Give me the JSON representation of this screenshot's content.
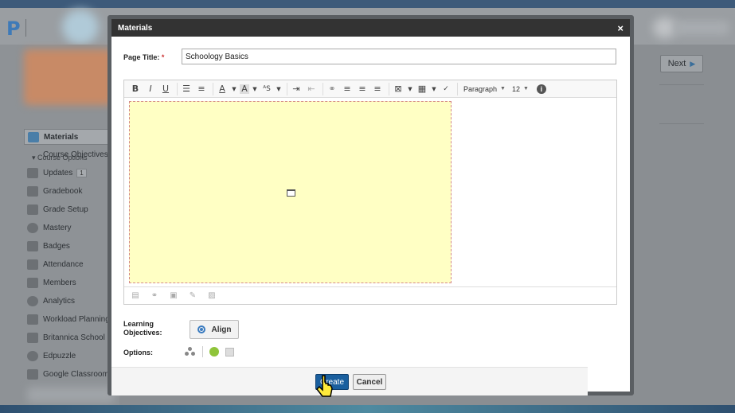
{
  "app": {
    "logo_letter": "P"
  },
  "sidebar": {
    "course_options": "Course Options",
    "items": [
      {
        "label": "Materials",
        "icon": "materials-icon",
        "active": true
      },
      {
        "label": "Course Objectives",
        "sub": true
      },
      {
        "label": "Updates",
        "icon": "updates-icon",
        "badge": "1"
      },
      {
        "label": "Gradebook",
        "icon": "gradebook-icon"
      },
      {
        "label": "Grade Setup",
        "icon": "grade-setup-icon"
      },
      {
        "label": "Mastery",
        "icon": "mastery-icon"
      },
      {
        "label": "Badges",
        "icon": "badges-icon"
      },
      {
        "label": "Attendance",
        "icon": "attendance-icon"
      },
      {
        "label": "Members",
        "icon": "members-icon"
      },
      {
        "label": "Analytics",
        "icon": "analytics-icon"
      },
      {
        "label": "Workload Planning",
        "icon": "workload-icon"
      },
      {
        "label": "Britannica School",
        "icon": "britannica-icon"
      },
      {
        "label": "Edpuzzle",
        "icon": "edpuzzle-icon"
      },
      {
        "label": "Google Classroom",
        "icon": "google-classroom-icon"
      }
    ]
  },
  "header": {
    "next_label": "Next",
    "next_arrow": "▶"
  },
  "modal": {
    "title": "Materials",
    "close": "×",
    "page_title_label": "Page Title:",
    "required_mark": "*",
    "page_title_value": "Schoology Basics",
    "toolbar": {
      "bold": "B",
      "italic": "I",
      "underline": "U",
      "paragraph": "Paragraph",
      "font_size": "12",
      "info": "i"
    },
    "learning_objectives_label": "Learning Objectives:",
    "align_label": "Align",
    "options_label": "Options:",
    "create_label": "Create",
    "cancel_label": "Cancel"
  },
  "colors": {
    "accent": "#1a5f9e",
    "editor_bg": "#ffffc4",
    "option_green": "#8fc43a"
  }
}
